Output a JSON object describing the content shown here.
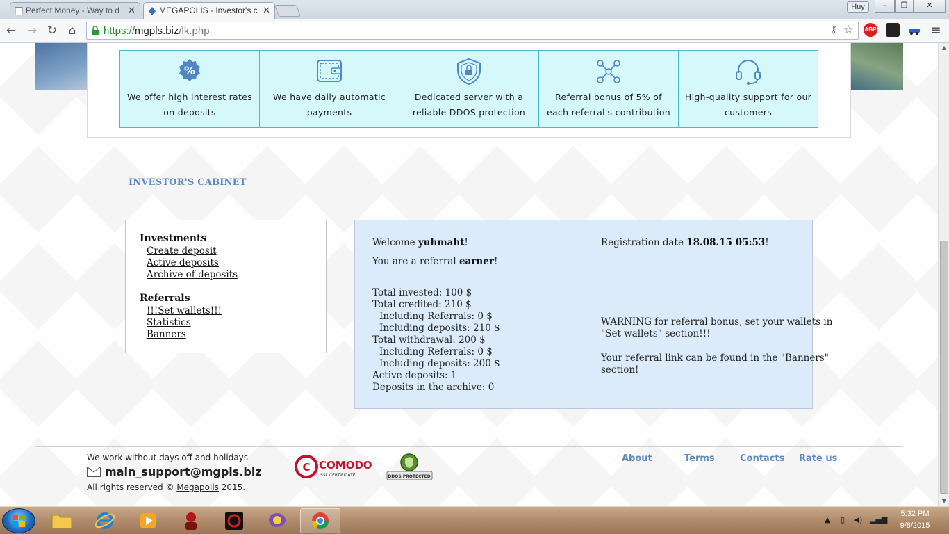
{
  "browser": {
    "tabs": [
      {
        "title": "Perfect Money - Way to d",
        "active": false
      },
      {
        "title": "MEGAPOLIS - Investor's c",
        "active": true
      }
    ],
    "user_badge": "Huy",
    "url": {
      "scheme": "https://",
      "host": "mgpls.biz",
      "path": "/lk.php"
    },
    "extensions": [
      "ABP"
    ]
  },
  "features": [
    {
      "icon": "percent-badge-icon",
      "text": "We offer high interest rates on deposits"
    },
    {
      "icon": "wallet-icon",
      "text": "We have daily automatic payments"
    },
    {
      "icon": "shield-lock-icon",
      "text": "Dedicated server with a reliable DDOS protection"
    },
    {
      "icon": "referral-network-icon",
      "text": "Referral bonus of 5% of each referral's contribution"
    },
    {
      "icon": "headset-icon",
      "text": "High-quality support for our customers"
    }
  ],
  "cabinet_title": "INVESTOR'S CABINET",
  "menu": {
    "investments_heading": "Investments",
    "investments": [
      "Create deposit",
      "Active deposits",
      "Archive of deposits"
    ],
    "referrals_heading": "Referrals",
    "referrals": [
      "!!!Set wallets!!!",
      "Statistics",
      "Banners"
    ]
  },
  "account": {
    "welcome_prefix": "Welcome ",
    "username": "yuhmaht",
    "welcome_suffix": "!",
    "referral_prefix": "You are a referral ",
    "referral_of": "earner",
    "referral_suffix": "!",
    "registration_prefix": "Registration date ",
    "registration_date": "18.08.15 05:53",
    "registration_suffix": "!",
    "stats": [
      "Total invested: 100 $",
      "Total credited: 210 $",
      "Including Referrals: 0 $",
      "Including deposits: 210 $",
      "Total withdrawal: 200 $",
      "Including Referrals: 0 $",
      "Including deposits: 200 $",
      "Active deposits: 1",
      "Deposits in the archive: 0"
    ],
    "warning_line1": "WARNING for referral bonus, set your wallets in",
    "warning_line2": "\"Set wallets\" section!!!",
    "referral_link_line1": "Your referral link can be found in the \"Banners\"",
    "referral_link_line2": "section!"
  },
  "footer": {
    "work_note": "We work without days off and holidays",
    "email": "main_support@mgpls.biz",
    "rights_prefix": "All rights reserved © ",
    "rights_link": "Megapolis",
    "rights_suffix": " 2015.",
    "badges": {
      "comodo": "COMODO",
      "comodo_sub": "SSL CERTIFICATE",
      "ddos": "DDOS PROTECTED"
    },
    "links": [
      "About",
      "Terms",
      "Contacts",
      "Rate us"
    ]
  },
  "taskbar": {
    "time": "5:32 PM",
    "date": "9/8/2015"
  },
  "colors": {
    "accent_blue": "#5d8bbd",
    "feature_bg": "#d5f8fb",
    "info_bg": "#dcebfa"
  }
}
